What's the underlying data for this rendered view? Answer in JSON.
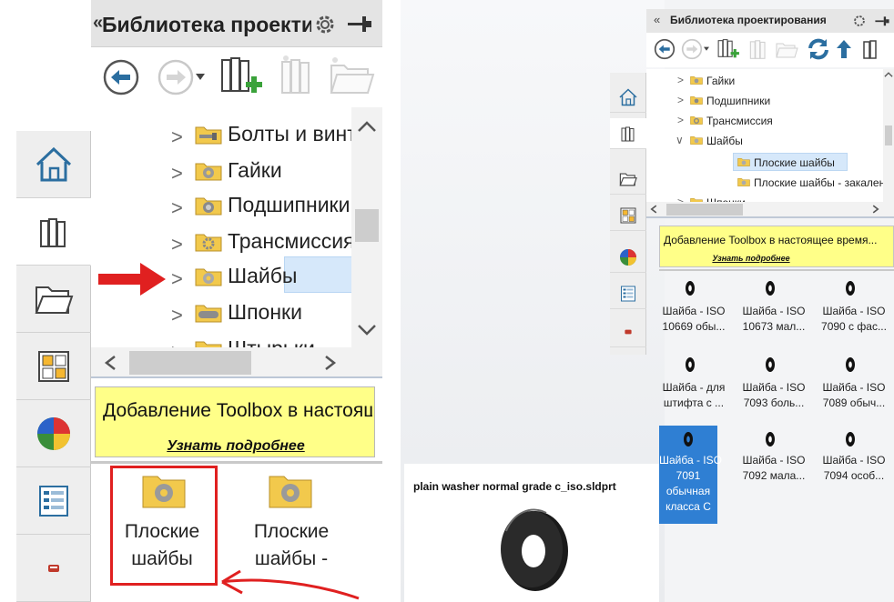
{
  "left_panel": {
    "title": "Библиотека проектирования",
    "tree_items": [
      {
        "label": "Болты и винты",
        "icon": "bolt-folder-icon"
      },
      {
        "label": "Гайки",
        "icon": "nut-folder-icon"
      },
      {
        "label": "Подшипники",
        "icon": "bearing-folder-icon"
      },
      {
        "label": "Трансмиссия",
        "icon": "gear-folder-icon"
      },
      {
        "label": "Шайбы",
        "icon": "washer-folder-icon",
        "selected": true
      },
      {
        "label": "Шпонки",
        "icon": "key-folder-icon"
      },
      {
        "label": "Штырьки",
        "icon": "pin-folder-icon"
      }
    ],
    "banner_text": "Добавление Toolbox в настоящее время...",
    "banner_link": "Узнать подробнее",
    "tiles": [
      {
        "label": "Плоские шайбы"
      },
      {
        "label": "Плоские шайбы - закаленные"
      }
    ]
  },
  "right_panel": {
    "title": "Библиотека проектирования",
    "collapse_glyph": "«",
    "tree_items": [
      {
        "label": "Гайки",
        "level": 1,
        "expanded": false
      },
      {
        "label": "Подшипники",
        "level": 1,
        "expanded": false
      },
      {
        "label": "Трансмиссия",
        "level": 1,
        "expanded": false
      },
      {
        "label": "Шайбы",
        "level": 1,
        "expanded": true
      },
      {
        "label": "Плоские шайбы",
        "level": 2,
        "selected": true
      },
      {
        "label": "Плоские шайбы - закаленные",
        "level": 2
      },
      {
        "label": "Шпонки",
        "level": 1
      }
    ],
    "banner_text": "Добавление Toolbox в настоящее время...",
    "banner_link": "Узнать подробнее",
    "items": [
      {
        "line1": "Шайба - ISO",
        "line2": "10669 обы..."
      },
      {
        "line1": "Шайба - ISO",
        "line2": "10673 мал..."
      },
      {
        "line1": "Шайба - ISO",
        "line2": "7090 с фас..."
      },
      {
        "line1": "Шайба - для",
        "line2": "штифта с ..."
      },
      {
        "line1": "Шайба - ISO",
        "line2": "7093 боль..."
      },
      {
        "line1": "Шайба - ISO",
        "line2": "7089 обыч..."
      },
      {
        "line1": "Шайба - ISO",
        "line2": "7091 обычная класса С",
        "selected": true
      },
      {
        "line1": "Шайба - ISO",
        "line2": "7092 мала..."
      },
      {
        "line1": "Шайба - ISO",
        "line2": "7094 особ..."
      }
    ],
    "preview_filename": "plain washer normal grade c_iso.sldprt"
  },
  "colors": {
    "annotation_red": "#e02020",
    "selection_blue": "#d6e8fa",
    "selected_item_blue": "#2f7fd3",
    "banner_yellow": "#ffff88",
    "folder_yellow": "#f2c94c"
  }
}
